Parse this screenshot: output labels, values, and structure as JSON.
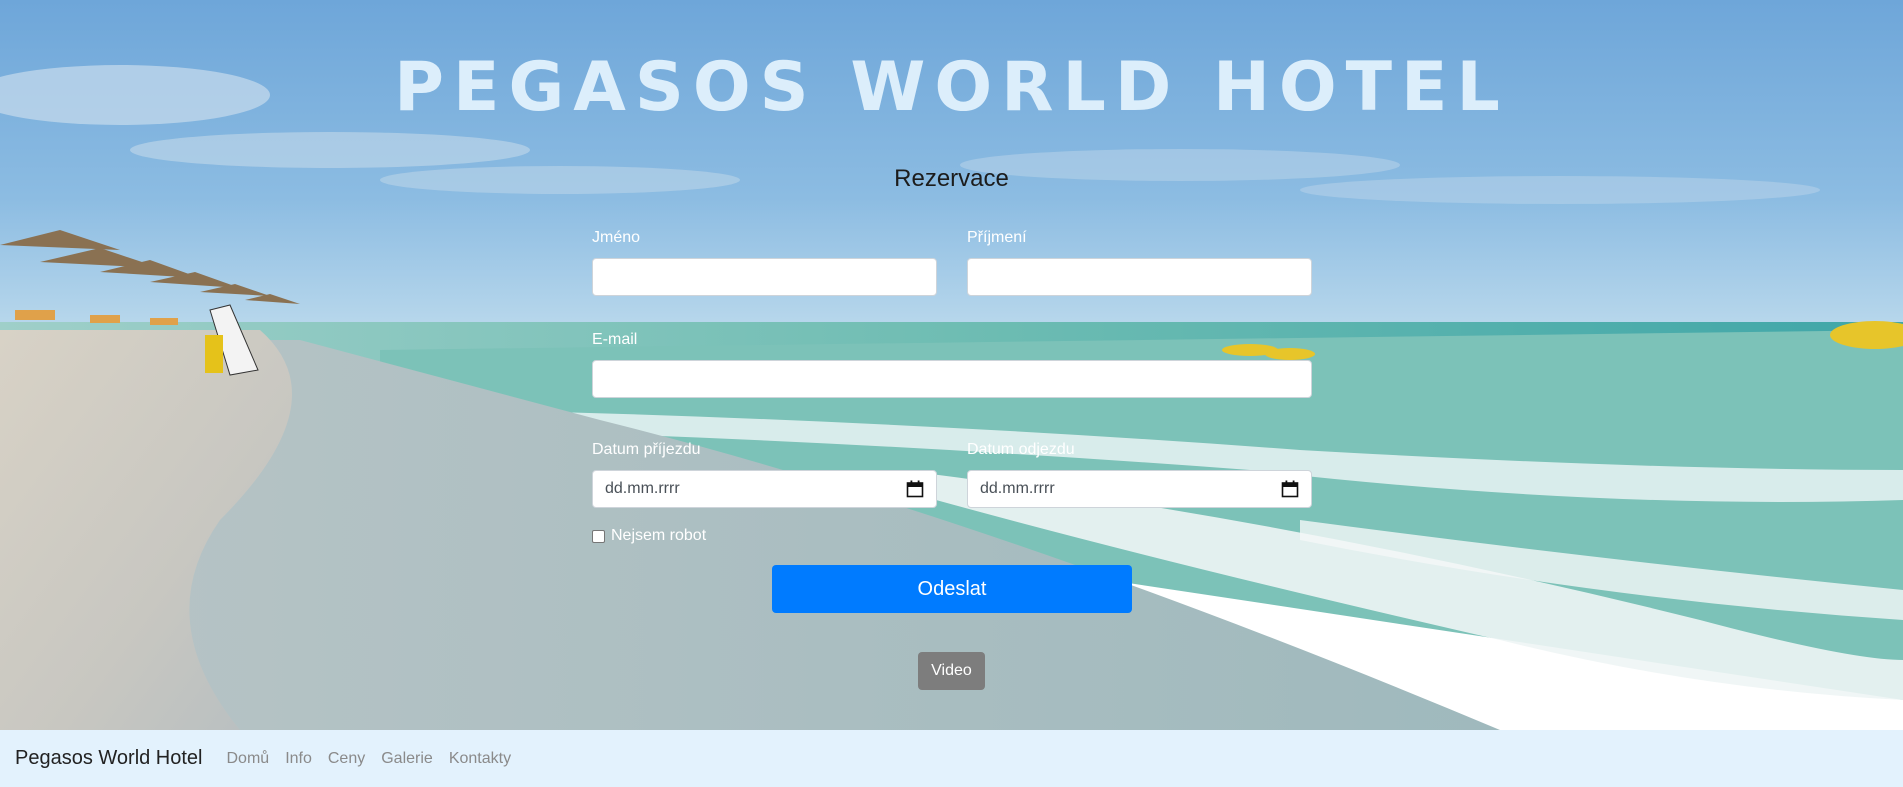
{
  "hero": {
    "title": "PEGASOS WORLD HOTEL",
    "form_heading": "Rezervace"
  },
  "form": {
    "first_name_label": "Jméno",
    "first_name_value": "",
    "last_name_label": "Příjmení",
    "last_name_value": "",
    "email_label": "E-mail",
    "email_value": "",
    "arrival_label": "Datum příjezdu",
    "arrival_placeholder": "dd.mm.rrrr",
    "departure_label": "Datum odjezdu",
    "departure_placeholder": "dd.mm.rrrr",
    "robot_label": "Nejsem robot",
    "robot_checked": false,
    "submit_label": "Odeslat",
    "video_label": "Video"
  },
  "navbar": {
    "brand": "Pegasos World Hotel",
    "links": [
      "Domů",
      "Info",
      "Ceny",
      "Galerie",
      "Kontakty"
    ]
  },
  "colors": {
    "primary_button": "#007bff",
    "secondary_button": "#7d7d7d",
    "navbar_bg": "#e3f2fd",
    "title": "#dceefb"
  },
  "icons": {
    "date_picker": "calendar-icon",
    "robot_check": "checkbox"
  }
}
